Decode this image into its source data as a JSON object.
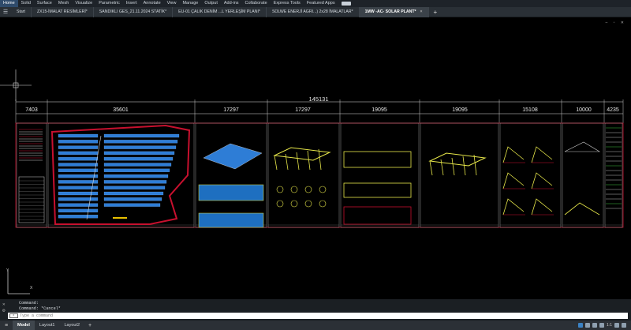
{
  "ribbon": {
    "tabs": [
      "Home",
      "Solid",
      "Surface",
      "Mesh",
      "Visualize",
      "Parametric",
      "Insert",
      "Annotate",
      "View",
      "Manage",
      "Output",
      "Add-ins",
      "Collaborate",
      "Express Tools",
      "Featured Apps"
    ],
    "active": "Home"
  },
  "file_tabs": {
    "start": "Start",
    "tabs": [
      {
        "label": "ZX15-İMALAT RESİMLERİ*"
      },
      {
        "label": "SANDIKLI GES_21.11.2024 STATİK*"
      },
      {
        "label": "EU-01 ÇALIK DENİM ...L YERLEŞİM PLANI*"
      },
      {
        "label": "SOLWE ENERJİ AGRI...) 2x28 İMALATLAR*"
      },
      {
        "label": "1MW -AC- SOLAR PLANT*",
        "active": true
      }
    ],
    "close_glyph": "×",
    "new_glyph": "+"
  },
  "drawing": {
    "total_dimension": "145131",
    "segment_dimensions": [
      "7403",
      "35601",
      "17297",
      "17297",
      "19095",
      "19095",
      "15108",
      "10000",
      "4235"
    ]
  },
  "ucs": {
    "x_label": "X",
    "y_label": "Y"
  },
  "command": {
    "history": [
      "Command:",
      "Command: *Cancel*"
    ],
    "placeholder": "Type a command"
  },
  "layout_tabs": {
    "tabs": [
      "Model",
      "Layout1",
      "Layout2"
    ],
    "active": "Model",
    "new_glyph": "+"
  },
  "status": {
    "zoom": "1:1"
  },
  "colors": {
    "accent": "#2f4b6b",
    "sheet_border": "#c8102e",
    "panel_blue": "#2e7dd6",
    "steel_yellow": "#e8e84a"
  }
}
